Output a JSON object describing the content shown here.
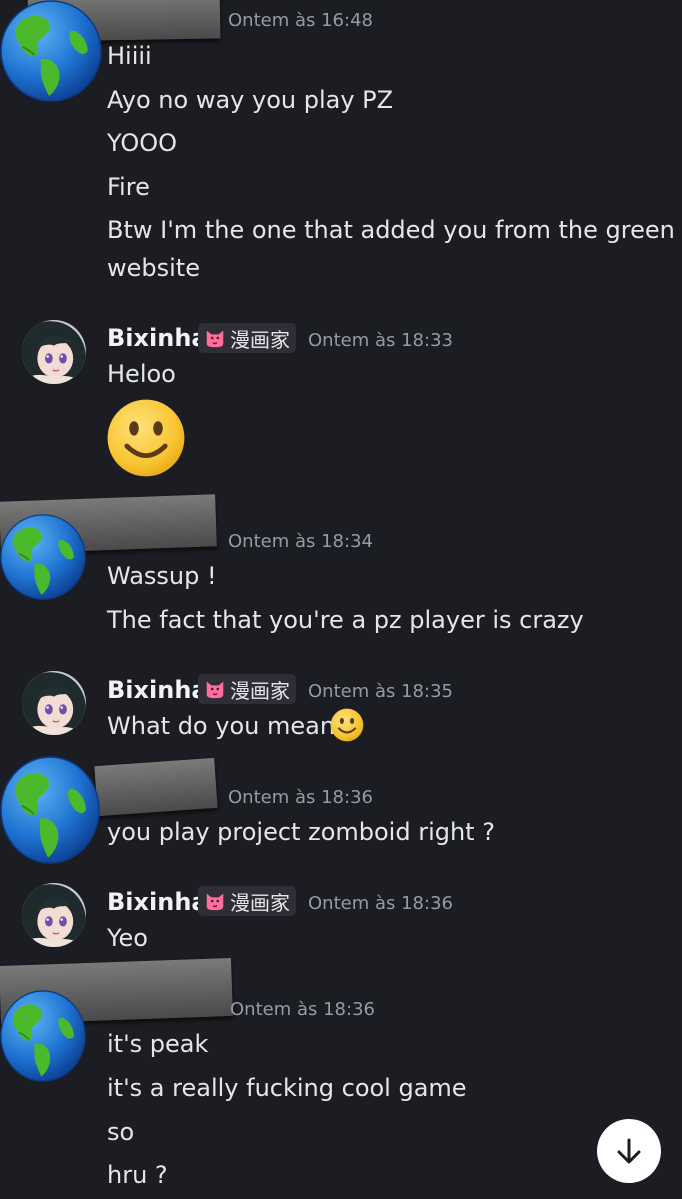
{
  "messages": {
    "m1": {
      "timestamp": "Ontem às 16:48",
      "lines": [
        "Hiiii",
        "Ayo no way you play PZ",
        "YOOO",
        "Fire",
        "Btw I'm the one that added you from the green",
        "website"
      ]
    },
    "m2": {
      "author": "Bixinha",
      "badge": "漫画家",
      "timestamp": "Ontem às 18:33",
      "lines": [
        "Heloo"
      ]
    },
    "m3": {
      "timestamp": "Ontem às 18:34",
      "lines": [
        "Wassup !",
        "The fact that you're a pz player is crazy"
      ]
    },
    "m4": {
      "author": "Bixinha",
      "badge": "漫画家",
      "timestamp": "Ontem às 18:35",
      "lines": [
        "What do you mean?"
      ]
    },
    "m5": {
      "timestamp": "Ontem às 18:36",
      "lines": [
        "you play project zomboid right ?"
      ]
    },
    "m6": {
      "author": "Bixinha",
      "badge": "漫画家",
      "timestamp": "Ontem às 18:36",
      "lines": [
        "Yeo"
      ]
    },
    "m7": {
      "timestamp": "Ontem às 18:36",
      "lines": [
        "it's peak",
        "it's a really fucking cool game",
        "so",
        "hru ?"
      ]
    }
  },
  "colors": {
    "background": "#1c1d22",
    "text": "#e4e6e9",
    "timestamp": "#949ba4",
    "badge_bg": "#2e2f36"
  },
  "icons": [
    "earth-globe-avatar",
    "anime-girl-avatar",
    "slightly-smiling-emoji",
    "cat-face-badge-icon",
    "arrow-down-icon"
  ]
}
